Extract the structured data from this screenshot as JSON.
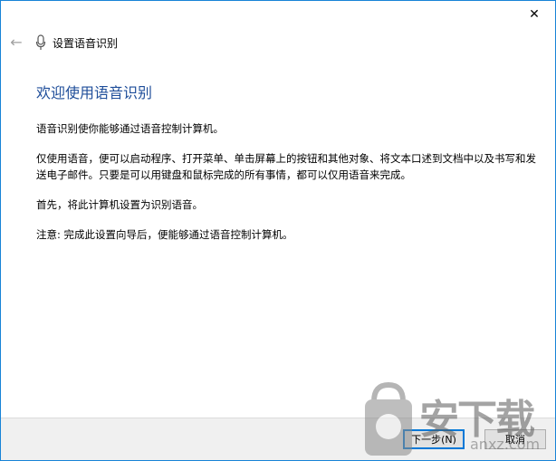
{
  "window": {
    "close_glyph": "✕"
  },
  "header": {
    "title": "设置语音识别",
    "back_glyph": "←"
  },
  "content": {
    "heading": "欢迎使用语音识别",
    "paragraphs": [
      "语音识别使你能够通过语音控制计算机。",
      "仅使用语音，便可以启动程序、打开菜单、单击屏幕上的按钮和其他对象、将文本口述到文档中以及书写和发送电子邮件。只要是可以用键盘和鼠标完成的所有事情，都可以仅用语音来完成。",
      "首先，将此计算机设置为识别语音。",
      "注意: 完成此设置向导后，便能够通过语音控制计算机。"
    ]
  },
  "footer": {
    "next_label": "下一步(N)",
    "cancel_label": "取消"
  },
  "watermark": {
    "text": "安下载",
    "sub": "anxz.com"
  },
  "colors": {
    "accent": "#1883d7",
    "heading": "#1f4e9a"
  }
}
